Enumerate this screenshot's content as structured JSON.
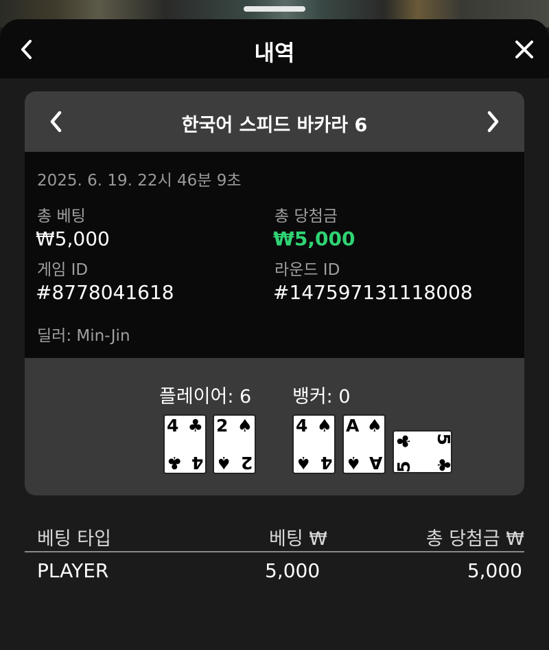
{
  "header": {
    "title": "내역",
    "back_icon": "chevron-left-icon",
    "close_icon": "close-icon"
  },
  "round": {
    "game_name": "한국어 스피드 바카라 6",
    "datetime": "2025. 6. 19. 22시 46분 9초",
    "total_bet_label": "총 베팅",
    "total_bet_value": "₩5,000",
    "total_win_label": "총 당첨금",
    "total_win_value": "₩5,000",
    "game_id_label": "게임 ID",
    "game_id_value": "#8778041618",
    "round_id_label": "라운드 ID",
    "round_id_value": "#147597131118008",
    "dealer": "딜러: Min-Jin"
  },
  "hands": {
    "player_label": "플레이어: 6",
    "banker_label": "뱅커: 0",
    "player_cards": [
      {
        "rank": "4",
        "suit": "♣"
      },
      {
        "rank": "2",
        "suit": "♠"
      }
    ],
    "banker_cards": [
      {
        "rank": "4",
        "suit": "♠"
      },
      {
        "rank": "A",
        "suit": "♠"
      },
      {
        "rank": "5",
        "suit": "♣"
      }
    ]
  },
  "bets_table": {
    "headers": [
      "베팅 타입",
      "베팅 ₩",
      "총 당첨금 ₩"
    ],
    "rows": [
      {
        "type": "PLAYER",
        "bet": "5,000",
        "win": "5,000"
      }
    ]
  },
  "colors": {
    "win_green": "#2fd373",
    "panel": "#3a3a3a",
    "info_bg": "#0a0a0a"
  }
}
